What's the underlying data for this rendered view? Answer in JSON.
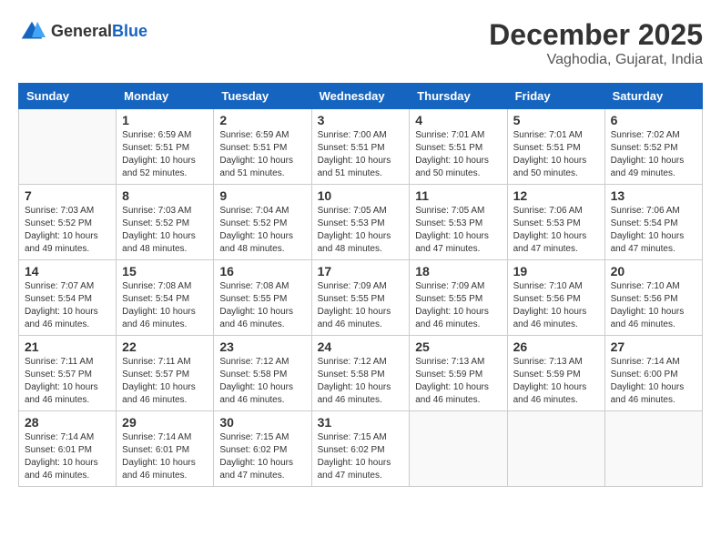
{
  "logo": {
    "general": "General",
    "blue": "Blue"
  },
  "header": {
    "month": "December 2025",
    "location": "Vaghodia, Gujarat, India"
  },
  "days_of_week": [
    "Sunday",
    "Monday",
    "Tuesday",
    "Wednesday",
    "Thursday",
    "Friday",
    "Saturday"
  ],
  "weeks": [
    [
      {
        "day": "",
        "info": ""
      },
      {
        "day": "1",
        "info": "Sunrise: 6:59 AM\nSunset: 5:51 PM\nDaylight: 10 hours\nand 52 minutes."
      },
      {
        "day": "2",
        "info": "Sunrise: 6:59 AM\nSunset: 5:51 PM\nDaylight: 10 hours\nand 51 minutes."
      },
      {
        "day": "3",
        "info": "Sunrise: 7:00 AM\nSunset: 5:51 PM\nDaylight: 10 hours\nand 51 minutes."
      },
      {
        "day": "4",
        "info": "Sunrise: 7:01 AM\nSunset: 5:51 PM\nDaylight: 10 hours\nand 50 minutes."
      },
      {
        "day": "5",
        "info": "Sunrise: 7:01 AM\nSunset: 5:51 PM\nDaylight: 10 hours\nand 50 minutes."
      },
      {
        "day": "6",
        "info": "Sunrise: 7:02 AM\nSunset: 5:52 PM\nDaylight: 10 hours\nand 49 minutes."
      }
    ],
    [
      {
        "day": "7",
        "info": "Sunrise: 7:03 AM\nSunset: 5:52 PM\nDaylight: 10 hours\nand 49 minutes."
      },
      {
        "day": "8",
        "info": "Sunrise: 7:03 AM\nSunset: 5:52 PM\nDaylight: 10 hours\nand 48 minutes."
      },
      {
        "day": "9",
        "info": "Sunrise: 7:04 AM\nSunset: 5:52 PM\nDaylight: 10 hours\nand 48 minutes."
      },
      {
        "day": "10",
        "info": "Sunrise: 7:05 AM\nSunset: 5:53 PM\nDaylight: 10 hours\nand 48 minutes."
      },
      {
        "day": "11",
        "info": "Sunrise: 7:05 AM\nSunset: 5:53 PM\nDaylight: 10 hours\nand 47 minutes."
      },
      {
        "day": "12",
        "info": "Sunrise: 7:06 AM\nSunset: 5:53 PM\nDaylight: 10 hours\nand 47 minutes."
      },
      {
        "day": "13",
        "info": "Sunrise: 7:06 AM\nSunset: 5:54 PM\nDaylight: 10 hours\nand 47 minutes."
      }
    ],
    [
      {
        "day": "14",
        "info": "Sunrise: 7:07 AM\nSunset: 5:54 PM\nDaylight: 10 hours\nand 46 minutes."
      },
      {
        "day": "15",
        "info": "Sunrise: 7:08 AM\nSunset: 5:54 PM\nDaylight: 10 hours\nand 46 minutes."
      },
      {
        "day": "16",
        "info": "Sunrise: 7:08 AM\nSunset: 5:55 PM\nDaylight: 10 hours\nand 46 minutes."
      },
      {
        "day": "17",
        "info": "Sunrise: 7:09 AM\nSunset: 5:55 PM\nDaylight: 10 hours\nand 46 minutes."
      },
      {
        "day": "18",
        "info": "Sunrise: 7:09 AM\nSunset: 5:55 PM\nDaylight: 10 hours\nand 46 minutes."
      },
      {
        "day": "19",
        "info": "Sunrise: 7:10 AM\nSunset: 5:56 PM\nDaylight: 10 hours\nand 46 minutes."
      },
      {
        "day": "20",
        "info": "Sunrise: 7:10 AM\nSunset: 5:56 PM\nDaylight: 10 hours\nand 46 minutes."
      }
    ],
    [
      {
        "day": "21",
        "info": "Sunrise: 7:11 AM\nSunset: 5:57 PM\nDaylight: 10 hours\nand 46 minutes."
      },
      {
        "day": "22",
        "info": "Sunrise: 7:11 AM\nSunset: 5:57 PM\nDaylight: 10 hours\nand 46 minutes."
      },
      {
        "day": "23",
        "info": "Sunrise: 7:12 AM\nSunset: 5:58 PM\nDaylight: 10 hours\nand 46 minutes."
      },
      {
        "day": "24",
        "info": "Sunrise: 7:12 AM\nSunset: 5:58 PM\nDaylight: 10 hours\nand 46 minutes."
      },
      {
        "day": "25",
        "info": "Sunrise: 7:13 AM\nSunset: 5:59 PM\nDaylight: 10 hours\nand 46 minutes."
      },
      {
        "day": "26",
        "info": "Sunrise: 7:13 AM\nSunset: 5:59 PM\nDaylight: 10 hours\nand 46 minutes."
      },
      {
        "day": "27",
        "info": "Sunrise: 7:14 AM\nSunset: 6:00 PM\nDaylight: 10 hours\nand 46 minutes."
      }
    ],
    [
      {
        "day": "28",
        "info": "Sunrise: 7:14 AM\nSunset: 6:01 PM\nDaylight: 10 hours\nand 46 minutes."
      },
      {
        "day": "29",
        "info": "Sunrise: 7:14 AM\nSunset: 6:01 PM\nDaylight: 10 hours\nand 46 minutes."
      },
      {
        "day": "30",
        "info": "Sunrise: 7:15 AM\nSunset: 6:02 PM\nDaylight: 10 hours\nand 47 minutes."
      },
      {
        "day": "31",
        "info": "Sunrise: 7:15 AM\nSunset: 6:02 PM\nDaylight: 10 hours\nand 47 minutes."
      },
      {
        "day": "",
        "info": ""
      },
      {
        "day": "",
        "info": ""
      },
      {
        "day": "",
        "info": ""
      }
    ]
  ]
}
